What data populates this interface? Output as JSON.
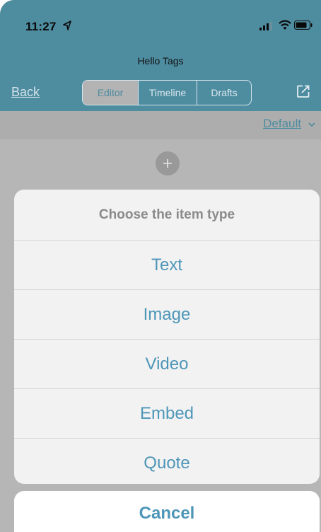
{
  "status_bar": {
    "time": "11:27",
    "icons": [
      "location-arrow-icon",
      "cellular-signal-icon",
      "wifi-icon",
      "battery-icon"
    ]
  },
  "nav": {
    "title": "Hello Tags",
    "back_label": "Back",
    "tabs": [
      {
        "label": "Editor",
        "active": true
      },
      {
        "label": "Timeline",
        "active": false
      },
      {
        "label": "Drafts",
        "active": false
      }
    ],
    "share_icon": "share-icon"
  },
  "filter": {
    "selected": "Default",
    "icon": "chevron-down-icon"
  },
  "content": {
    "add_icon": "plus-icon"
  },
  "action_sheet": {
    "title": "Choose the item type",
    "items": [
      "Text",
      "Image",
      "Video",
      "Embed",
      "Quote"
    ],
    "cancel_label": "Cancel"
  },
  "colors": {
    "accent": "#4e96b8",
    "header_dimmed": "#4e8ca0",
    "overlay_gray": "#b6b6b6"
  }
}
